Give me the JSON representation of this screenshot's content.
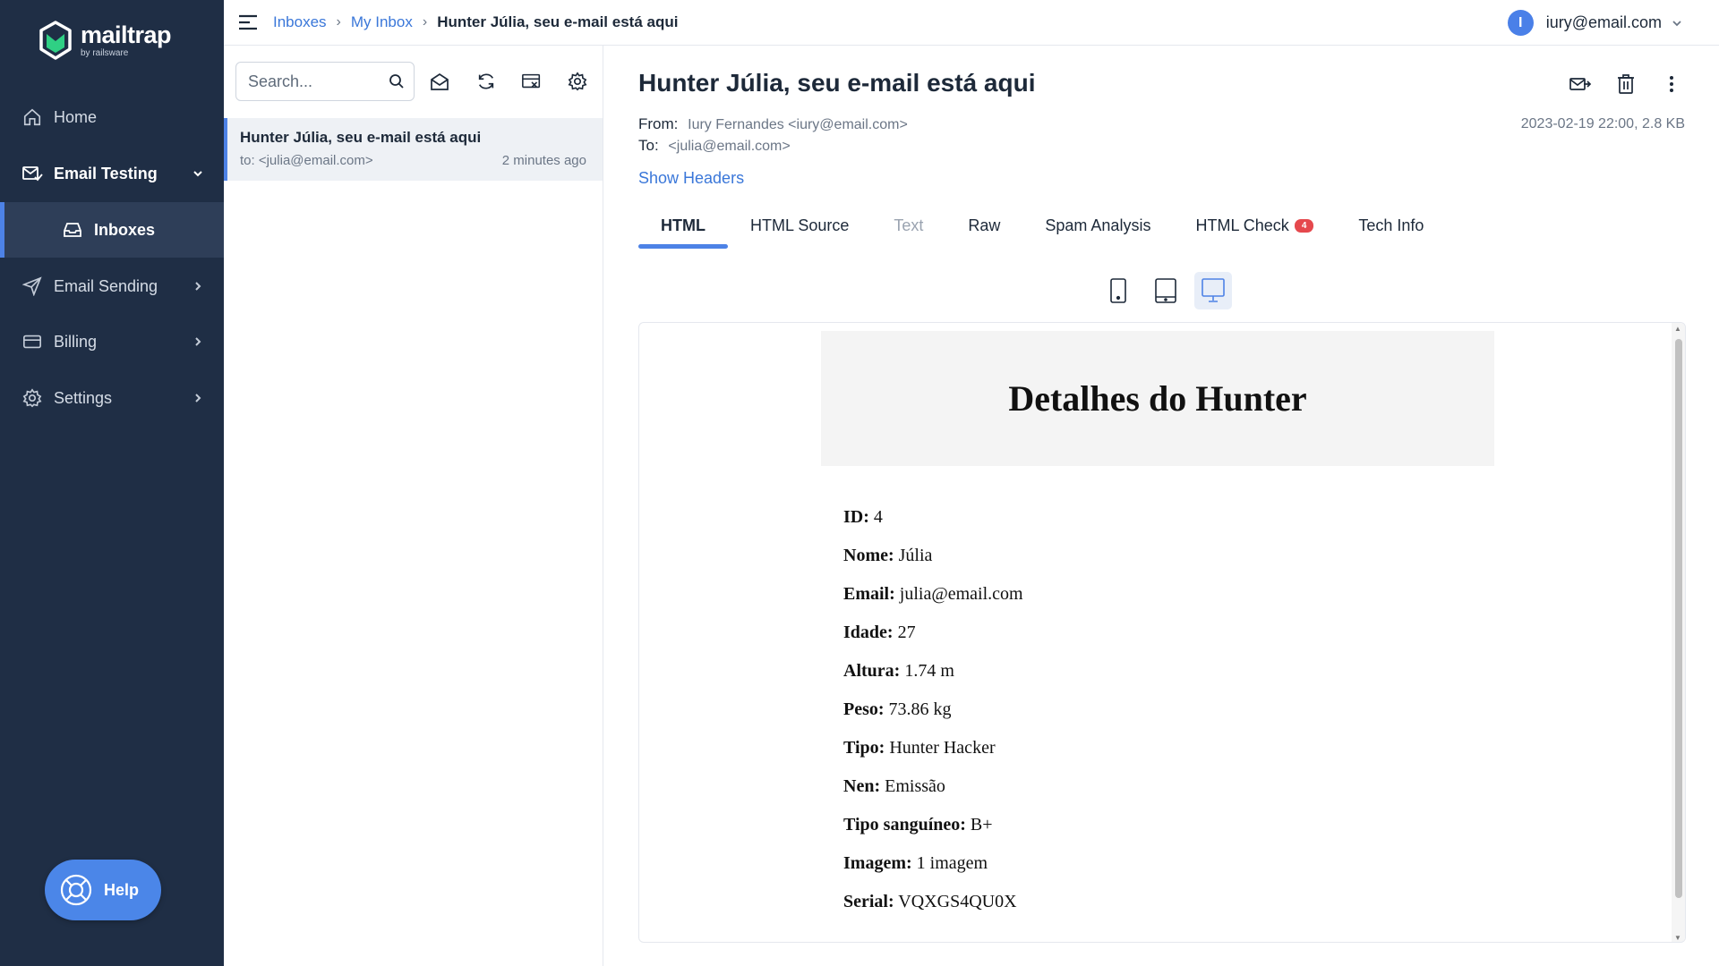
{
  "app": {
    "logo_name": "mailtrap",
    "logo_sub": "by railsware",
    "colors": {
      "sidebar": "#1f2e45",
      "accent": "#4d82e6",
      "logo_green": "#2fd084",
      "badge": "#e5484d"
    }
  },
  "sidebar": {
    "items": [
      {
        "label": "Home",
        "icon": "home-icon"
      },
      {
        "label": "Email Testing",
        "icon": "email-testing-icon",
        "expanded": true
      },
      {
        "label": "Inboxes",
        "icon": "inbox-icon",
        "active": true
      },
      {
        "label": "Email Sending",
        "icon": "send-icon"
      },
      {
        "label": "Billing",
        "icon": "billing-icon"
      },
      {
        "label": "Settings",
        "icon": "gear-icon"
      }
    ],
    "help_label": "Help"
  },
  "topbar": {
    "breadcrumb": [
      "Inboxes",
      "My Inbox",
      "Hunter Júlia, seu e-mail está aqui"
    ],
    "account_initial": "I",
    "account_email": "iury@email.com"
  },
  "list": {
    "search_placeholder": "Search...",
    "messages": [
      {
        "subject": "Hunter Júlia, seu e-mail está aqui",
        "to": "to: <julia@email.com>",
        "time": "2 minutes ago"
      }
    ]
  },
  "message": {
    "subject": "Hunter Júlia, seu e-mail está aqui",
    "from_label": "From:",
    "from": "Iury Fernandes <iury@email.com>",
    "to_label": "To:",
    "to": "<julia@email.com>",
    "date_size": "2023-02-19 22:00, 2.8 KB",
    "show_headers": "Show Headers",
    "tabs": [
      {
        "label": "HTML",
        "active": true
      },
      {
        "label": "HTML Source"
      },
      {
        "label": "Text",
        "disabled": true
      },
      {
        "label": "Raw"
      },
      {
        "label": "Spam Analysis"
      },
      {
        "label": "HTML Check",
        "badge": "4"
      },
      {
        "label": "Tech Info"
      }
    ],
    "preview_mode": "desktop"
  },
  "email": {
    "title": "Detalhes do Hunter",
    "fields": [
      {
        "label": "ID:",
        "value": "4"
      },
      {
        "label": "Nome:",
        "value": "Júlia"
      },
      {
        "label": "Email:",
        "value": "julia@email.com"
      },
      {
        "label": "Idade:",
        "value": "27"
      },
      {
        "label": "Altura:",
        "value": "1.74 m"
      },
      {
        "label": "Peso:",
        "value": "73.86 kg"
      },
      {
        "label": "Tipo:",
        "value": "Hunter Hacker"
      },
      {
        "label": "Nen:",
        "value": "Emissão"
      },
      {
        "label": "Tipo sanguíneo:",
        "value": "B+"
      },
      {
        "label": "Imagem:",
        "value": "1 imagem"
      },
      {
        "label": "Serial:",
        "value": "VQXGS4QU0X"
      }
    ]
  }
}
